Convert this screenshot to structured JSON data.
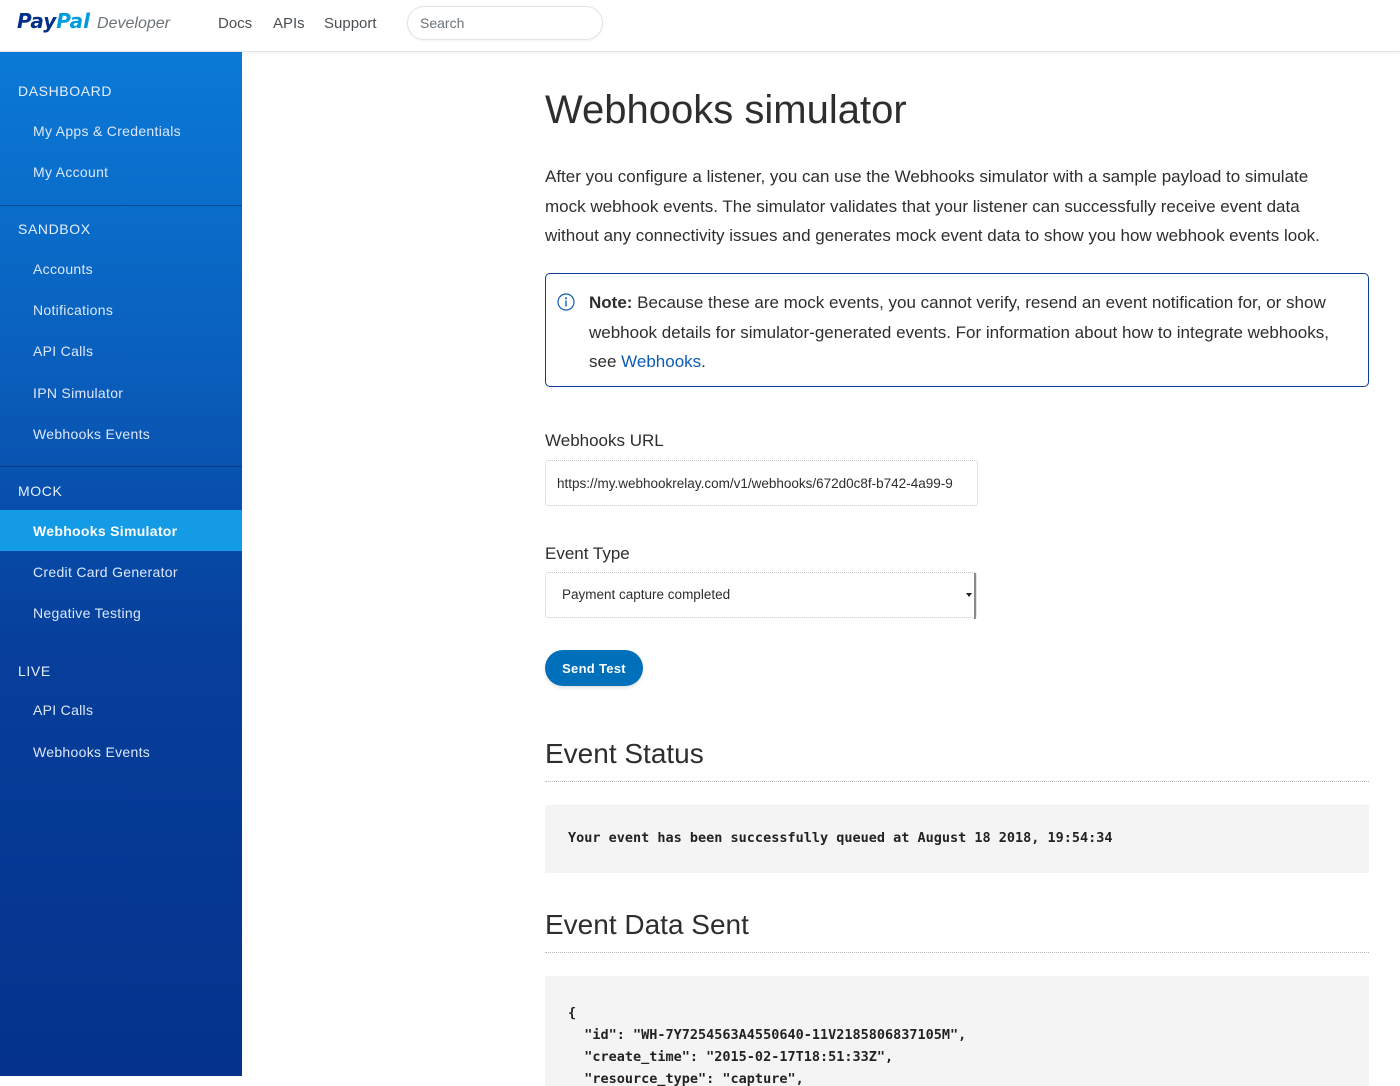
{
  "header": {
    "logo_pay": "Pay",
    "logo_pal": "Pal",
    "logo_developer": "Developer",
    "nav": [
      "Docs",
      "APIs",
      "Support"
    ],
    "search_placeholder": "Search"
  },
  "sidebar": {
    "dashboard": {
      "title": "DASHBOARD",
      "items": [
        "My Apps & Credentials",
        "My Account"
      ]
    },
    "sandbox": {
      "title": "SANDBOX",
      "items": [
        "Accounts",
        "Notifications",
        "API Calls",
        "IPN Simulator",
        "Webhooks Events"
      ]
    },
    "mock": {
      "title": "MOCK",
      "items": [
        "Webhooks Simulator",
        "Credit Card Generator",
        "Negative Testing"
      ],
      "active": "Webhooks Simulator"
    },
    "live": {
      "title": "LIVE",
      "items": [
        "API Calls",
        "Webhooks Events"
      ]
    }
  },
  "main": {
    "title": "Webhooks simulator",
    "intro": "After you configure a listener, you can use the Webhooks simulator with a sample payload to simulate mock webhook events. The simulator validates that your listener can successfully receive event data without any connectivity issues and generates mock event data to show you how webhook events look.",
    "note": {
      "label": "Note:",
      "text": " Because these are mock events, you cannot verify, resend an event notification for, or show webhook details for simulator-generated events. For information about how to integrate webhooks, see ",
      "link": "Webhooks",
      "after": "."
    },
    "url_label": "Webhooks URL",
    "url_value": "https://my.webhookrelay.com/v1/webhooks/672d0c8f-b742-4a99-9",
    "event_type_label": "Event Type",
    "event_type_value": "Payment capture completed",
    "send_button": "Send Test",
    "status_heading": "Event Status",
    "status_message": "Your event has been successfully queued at August 18 2018, 19:54:34",
    "data_heading": "Event Data Sent",
    "data_lines": [
      "{",
      "  \"id\": \"WH-7Y7254563A4550640-11V2185806837105M\",",
      "  \"create_time\": \"2015-02-17T18:51:33Z\",",
      "  \"resource_type\": \"capture\","
    ]
  },
  "colors": {
    "brand_dark": "#003087",
    "brand_light": "#009cde",
    "sidebar_active": "#139be6",
    "button": "#0070ba",
    "note_border": "#0d3f9a",
    "link": "#0d5cb4"
  },
  "icons": [
    "info-icon",
    "caret-down-icon"
  ]
}
